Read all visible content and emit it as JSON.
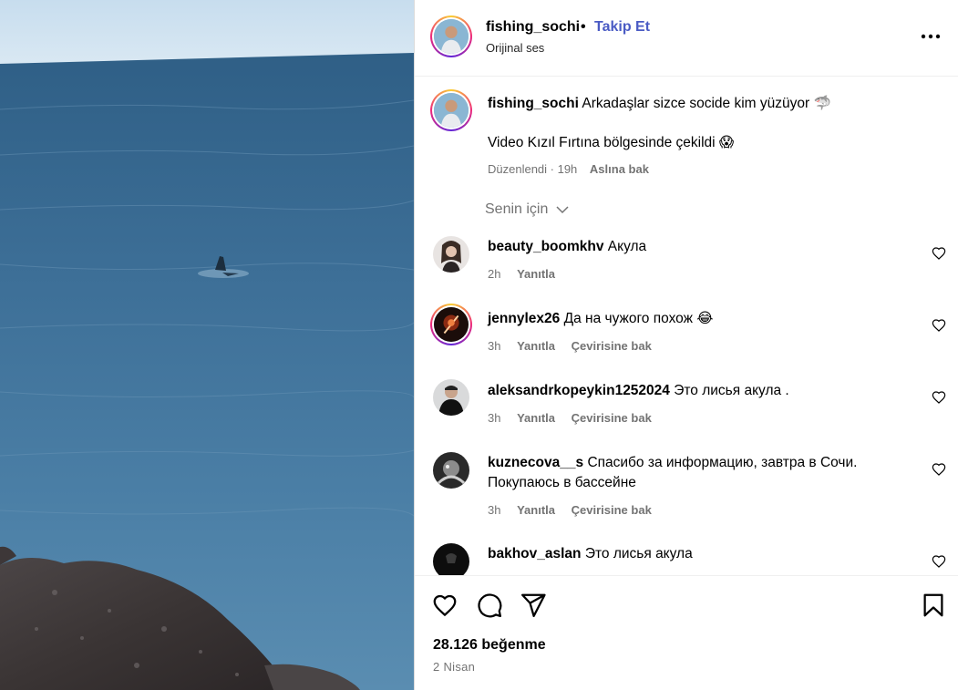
{
  "header": {
    "username": "fishing_sochi",
    "separator": "•",
    "follow_label": "Takip Et",
    "audio_label": "Orijinal ses"
  },
  "caption": {
    "username": "fishing_sochi",
    "text_line1": "Arkadaşlar sizce socide kim yüzüyor 🦈",
    "text_line2": "Video Kızıl Fırtına bölgesinde çekildi 😱",
    "edited_label": "Düzenlendi · 19h",
    "see_original_label": "Aslına bak"
  },
  "filter": {
    "label": "Senin için"
  },
  "comments": [
    {
      "username": "beauty_boomkhv",
      "text": "Акула",
      "time": "2h",
      "reply_label": "Yanıtla",
      "translate_label": ""
    },
    {
      "username": "jennylex26",
      "text": "Да на чужого похож 😂",
      "time": "3h",
      "reply_label": "Yanıtla",
      "translate_label": "Çevirisine bak"
    },
    {
      "username": "aleksandrkopeykin1252024",
      "text": "Это лисья акула .",
      "time": "3h",
      "reply_label": "Yanıtla",
      "translate_label": "Çevirisine bak"
    },
    {
      "username": "kuznecova__s",
      "text": "Спасибо за информацию, завтра в Сочи. Покупаюсь в бассейне",
      "time": "3h",
      "reply_label": "Yanıtla",
      "translate_label": "Çevirisine bak"
    },
    {
      "username": "bakhov_aslan",
      "text": "Это лисья акула",
      "time": "",
      "reply_label": "",
      "translate_label": ""
    }
  ],
  "footer": {
    "likes_label": "28.126 beğenme",
    "date_label": "2 Nisan"
  },
  "icons": {
    "more": "more-options-icon",
    "like": "heart-icon",
    "comment": "comment-icon",
    "share": "share-icon",
    "save": "bookmark-icon",
    "comment_like": "heart-small-icon",
    "filter_chevron": "chevron-down-icon"
  },
  "colors": {
    "follow": "#4a5bc4",
    "secondary_text": "#737373",
    "sea": "#3f7097",
    "sky": "#cfe2ef"
  }
}
